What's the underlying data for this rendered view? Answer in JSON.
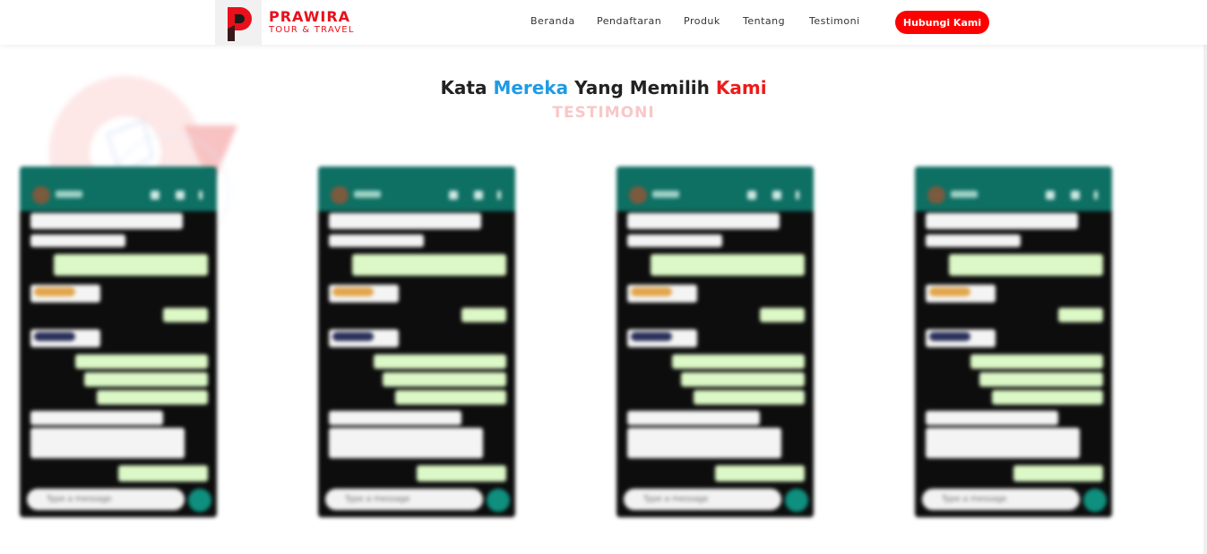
{
  "brand": {
    "name": "PRAWIRA",
    "tagline": "TOUR & TRAVEL",
    "color": "#e8101b"
  },
  "nav": {
    "items": [
      "Beranda",
      "Pendaftaran",
      "Produk",
      "Tentang",
      "Testimoni"
    ],
    "cta_label": "Hubungi Kami",
    "cta_color": "#ff0000"
  },
  "section": {
    "title_part1": "Kata ",
    "title_part2": "Mereka",
    "title_part3": " Yang Memilih ",
    "title_part4": "Kami",
    "subtitle": "TESTIMONI",
    "accent_blue": "#1e9be6",
    "accent_red": "#ee1b1b"
  },
  "testimonials": {
    "count": 4,
    "input_placeholder": "Type a message"
  }
}
